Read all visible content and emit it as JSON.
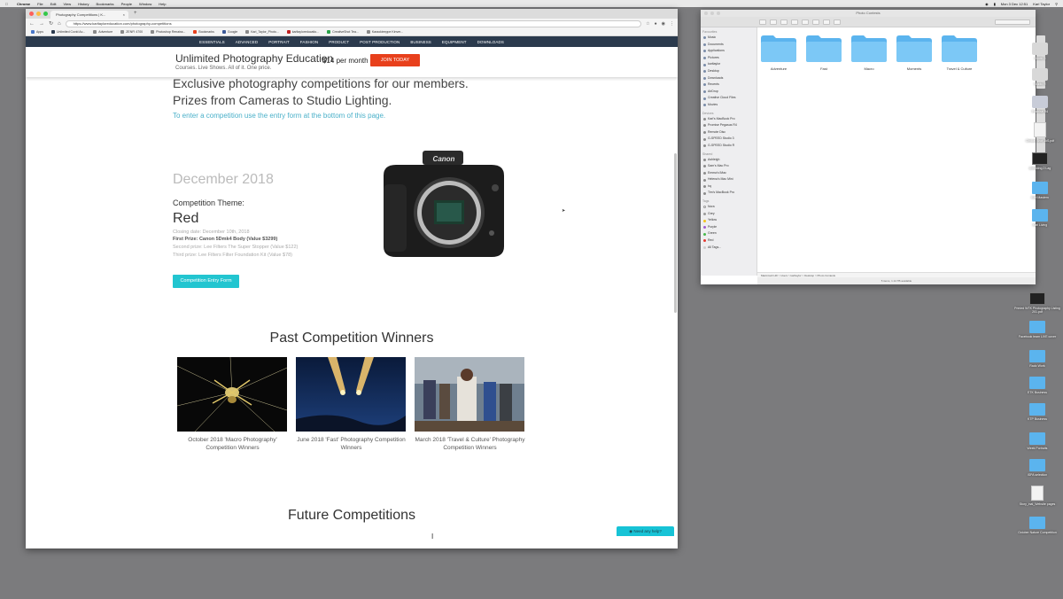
{
  "menubar": {
    "app": "Chrome",
    "items": [
      "File",
      "Edit",
      "View",
      "History",
      "Bookmarks",
      "People",
      "Window",
      "Help"
    ],
    "clock": "Mon 3 Dec 12:51",
    "user": "Karl Taylor"
  },
  "browser": {
    "tab_title": "Photography Competitions | K...",
    "url": "https://www.karltayloreducation.com/photography-competitions",
    "bookmarks": [
      "Apps",
      "Unlimited Covid Ac...",
      "Adventure",
      "ZENFI 4700",
      "Photoshop Renaiss...",
      "Bookmarks",
      "Google",
      "Karl_Taylor_Photo...",
      "karltayloreducatio...",
      "CreativeShot Tea...",
      "Karaokieeppe Kinver..."
    ],
    "site_nav": [
      "ESSENTIALS",
      "ADVANCED",
      "PORTRAIT",
      "FASHION",
      "PRODUCT",
      "POST PRODUCTION",
      "BUSINESS",
      "EQUIPMENT",
      "DOWNLOADS"
    ]
  },
  "banner": {
    "title": "Unlimited Photography Education",
    "subtitle": "Courses. Live Shows. All of it. One price.",
    "price": "$14 per month",
    "cta": "JOIN TODAY"
  },
  "content": {
    "headline_1": "Exclusive photography competitions for our members.",
    "headline_2": "Prizes from Cameras to Studio Lighting.",
    "enter_link": "To enter a competition use the entry form at the bottom of this page.",
    "month": "December 2018",
    "theme_label": "Competition Theme:",
    "theme": "Red",
    "closing": "Closing date: December 10th, 2018",
    "first_prize": "First Prize: Canon 5Dmk4 Body (Value $3299)",
    "second_prize": "Second prize: Lee Filters The Super Stopper (Value $122)",
    "third_prize": "Third prize: Lee Filters Filter Foundation Kit (Value $78)",
    "entry_button": "Competition Entry Form",
    "past_title": "Past Competition Winners",
    "winners": [
      {
        "caption_1": "October 2018 'Macro Photography'",
        "caption_2": "Competition Winners"
      },
      {
        "caption_1": "June 2018 'Fast' Photography Competition",
        "caption_2": "Winners"
      },
      {
        "caption_1": "March 2018 'Travel & Culture' Photography",
        "caption_2": "Competition Winners"
      }
    ],
    "future_title": "Future Competitions",
    "help": "Need any help?"
  },
  "finder": {
    "title": "Photo Contests",
    "favourites_head": "Favourites",
    "favourites": [
      "Music",
      "Documents",
      "Applications",
      "Pictures",
      "karltaylor",
      "Desktop",
      "Downloads",
      "Recents",
      "AirDrop",
      "Creative Cloud Files",
      "Movies"
    ],
    "devices_head": "Devices",
    "devices": [
      "Karl's MacBook Pro",
      "Promise Pegasus R4",
      "Remote Disc",
      "G-SPEED Studio 3",
      "G-SPEED Studio R"
    ],
    "shared_head": "Shared",
    "shared": [
      "Ashleigh",
      "Sam's Mac Pro",
      "Emma's iMac",
      "Helena's Mac Mini",
      "hq",
      "Tim's MacBook Pro"
    ],
    "tags_head": "Tags",
    "tags": [
      {
        "name": "Nora",
        "color": "#ffffff"
      },
      {
        "name": "Grey",
        "color": "#9a9a9a"
      },
      {
        "name": "Yellow",
        "color": "#f2c31c"
      },
      {
        "name": "Purple",
        "color": "#a05bd1"
      },
      {
        "name": "Green",
        "color": "#46b84a"
      },
      {
        "name": "Red",
        "color": "#e53a32"
      },
      {
        "name": "All Tags...",
        "color": "#cccccc"
      }
    ],
    "folders": [
      "Adventure",
      "Fast",
      "Macro",
      "Moments",
      "Travel & Culture"
    ],
    "path": "Macintosh HD > Users > karltaylor > Desktop > Photo Contests",
    "status": "5 items, 1.14 TB available"
  },
  "desktop": {
    "icons": [
      "Studio 3",
      "Studio R",
      "Promise R4",
      "Clinical Shot 1kS.pdf",
      "Unfolding 2 Lag",
      "Karl Mastem",
      "Kari Living",
      "Printed WTK Photography Listing 201.pdf",
      "Facebook team LIVE cover",
      "Rado Work",
      "ETK Business",
      "KTP Business",
      "Week Portraits",
      "ISPA selection",
      "Story_inal_Website pages",
      "October Nature Competition"
    ]
  },
  "colors": {
    "accent_teal": "#22c5d0",
    "join_orange": "#e8401c",
    "nav_navy": "#2b3a4d",
    "link_blue": "#4ab0c9"
  }
}
